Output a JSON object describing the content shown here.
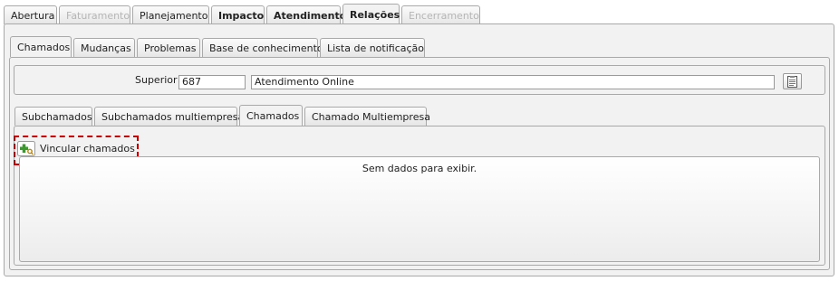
{
  "main_tabs": [
    {
      "label": "Abertura",
      "state": "normal"
    },
    {
      "label": "Faturamento",
      "state": "disabled"
    },
    {
      "label": "Planejamento",
      "state": "normal"
    },
    {
      "label": "Impacto",
      "state": "bold"
    },
    {
      "label": "Atendimento",
      "state": "bold"
    },
    {
      "label": "Relações",
      "state": "active"
    },
    {
      "label": "Encerramento",
      "state": "disabled"
    }
  ],
  "relations_tabs": [
    "Chamados",
    "Mudanças",
    "Problemas",
    "Base de conhecimento",
    "Lista de notificação"
  ],
  "superior": {
    "label": "Superior :",
    "id_value": "687",
    "name_value": "Atendimento Online",
    "lookup_icon": "document-list-icon"
  },
  "sub_tabs": [
    "Subchamados",
    "Subchamados multiempresa",
    "Chamados",
    "Chamado Multiempresa"
  ],
  "toolbar": {
    "link_label": "Vincular chamados",
    "link_icon": "add-link-icon"
  },
  "grid": {
    "empty_message": "Sem dados para exibir."
  },
  "colors": {
    "highlight": "#cc0000",
    "panel_bg": "#f2f2f2",
    "border": "#a9a9a9",
    "disabled_text": "#b5b5b5"
  }
}
